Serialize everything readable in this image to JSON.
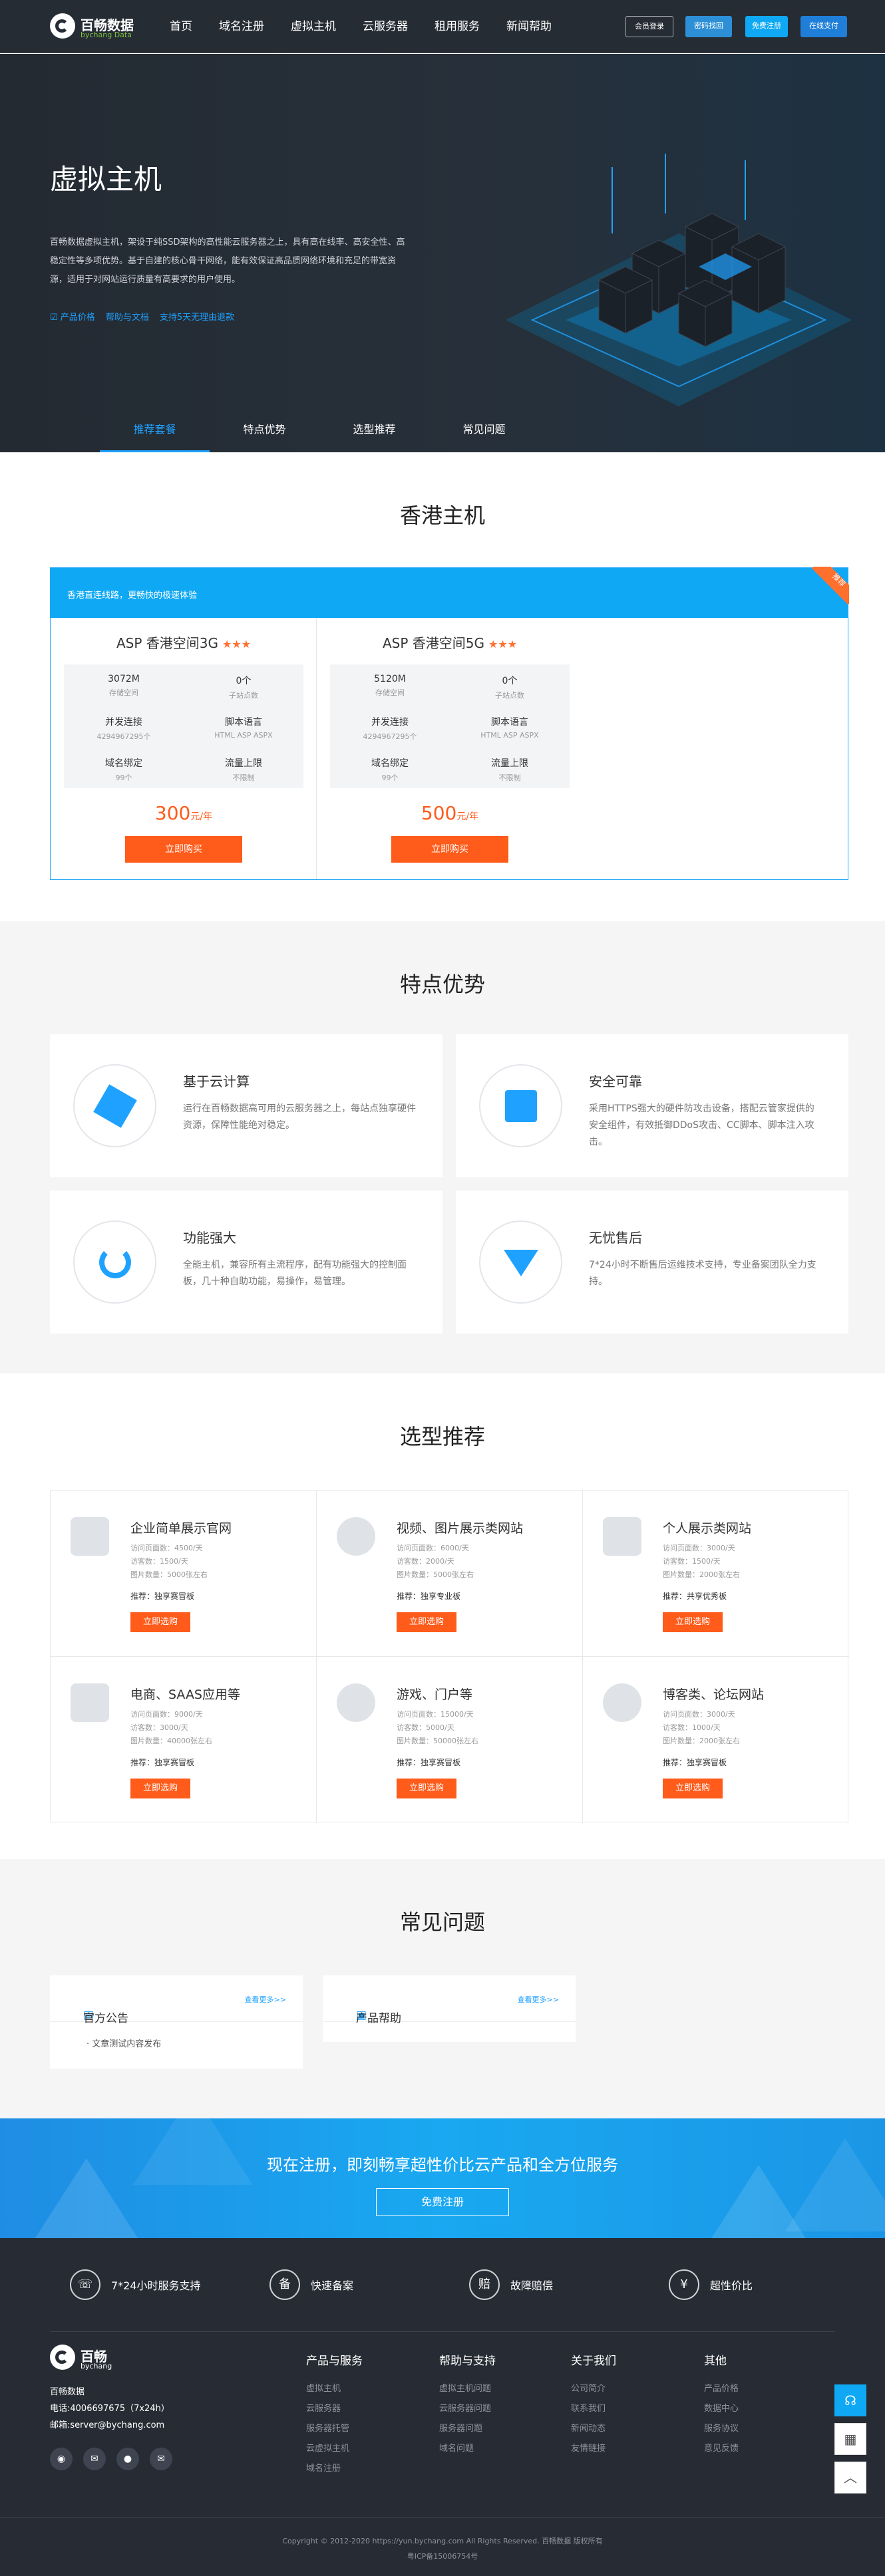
{
  "header": {
    "logo_cn": "百畅数据",
    "logo_en": "bychang Data",
    "nav": [
      "首页",
      "域名注册",
      "虚拟主机",
      "云服务器",
      "租用服务",
      "新闻帮助"
    ],
    "btn_login": "会员登录",
    "btn_find": "密码找回",
    "btn_register": "免费注册",
    "btn_pay": "在线支付"
  },
  "hero": {
    "title": "虚拟主机",
    "desc": "百畅数据虚拟主机，架设于纯SSD架构的高性能云服务器之上，具有高在线率、高安全性、高稳定性等多项优势。基于自建的核心骨干网络，能有效保证高品质网络环境和充足的带宽资源，适用于对网站运行质量有高要求的用户使用。",
    "features": [
      "产品价格",
      "帮助与文档",
      "支持5天无理由退款"
    ],
    "tabs": [
      "推荐套餐",
      "特点优势",
      "选型推荐",
      "常见问题"
    ]
  },
  "hk": {
    "title": "香港主机",
    "bar_text": "香港直连线路，更畅快的极速体验",
    "ribbon": "推荐",
    "plans": [
      {
        "name": "ASP 香港空间3G",
        "stars": "★★★",
        "cells": [
          {
            "v": "3072M",
            "l": "存储空间"
          },
          {
            "v": "0个",
            "l": "子站点数"
          },
          {
            "v": "并发连接",
            "l": "4294967295个"
          },
          {
            "v": "脚本语言",
            "l": "HTML ASP ASPX"
          },
          {
            "v": "域名绑定",
            "l": "99个"
          },
          {
            "v": "流量上限",
            "l": "不限制"
          }
        ],
        "price": "300",
        "unit": "元/年",
        "buy": "立即购买"
      },
      {
        "name": "ASP 香港空间5G",
        "stars": "★★★",
        "cells": [
          {
            "v": "5120M",
            "l": "存储空间"
          },
          {
            "v": "0个",
            "l": "子站点数"
          },
          {
            "v": "并发连接",
            "l": "4294967295个"
          },
          {
            "v": "脚本语言",
            "l": "HTML ASP ASPX"
          },
          {
            "v": "域名绑定",
            "l": "99个"
          },
          {
            "v": "流量上限",
            "l": "不限制"
          }
        ],
        "price": "500",
        "unit": "元/年",
        "buy": "立即购买"
      }
    ]
  },
  "features": {
    "title": "特点优势",
    "items": [
      {
        "title": "基于云计算",
        "desc": "运行在百畅数据高可用的云服务器之上，每站点独享硬件资源，保障性能绝对稳定。"
      },
      {
        "title": "安全可靠",
        "desc": "采用HTTPS强大的硬件防攻击设备，搭配云管家提供的安全组件，有效抵御DDoS攻击、CC脚本、脚本注入攻击。"
      },
      {
        "title": "功能强大",
        "desc": "全能主机，兼容所有主流程序，配有功能强大的控制面板，几十种自助功能，易操作，易管理。"
      },
      {
        "title": "无忧售后",
        "desc": "7*24小时不断售后运维技术支持，专业备案团队全力支持。"
      }
    ]
  },
  "recommend": {
    "title": "选型推荐",
    "items": [
      {
        "title": "企业简单展示官网",
        "l1": "访问页面数：4500/天",
        "l2": "访客数：1500/天",
        "l3": "图片数量：5000张左右",
        "rec": "推荐：独享赛冒板",
        "btn": "立即选购"
      },
      {
        "title": "视频、图片展示类网站",
        "l1": "访问页面数：6000/天",
        "l2": "访客数：2000/天",
        "l3": "图片数量：5000张左右",
        "rec": "推荐：独享专业板",
        "btn": "立即选购"
      },
      {
        "title": "个人展示类网站",
        "l1": "访问页面数：3000/天",
        "l2": "访客数：1500/天",
        "l3": "图片数量：2000张左右",
        "rec": "推荐：共享优秀板",
        "btn": "立即选购"
      },
      {
        "title": "电商、SAAS应用等",
        "l1": "访问页面数：9000/天",
        "l2": "访客数：3000/天",
        "l3": "图片数量：40000张左右",
        "rec": "推荐：独享赛冒板",
        "btn": "立即选购"
      },
      {
        "title": "游戏、门户等",
        "l1": "访问页面数：15000/天",
        "l2": "访客数：5000/天",
        "l3": "图片数量：50000张左右",
        "rec": "推荐：独享赛冒板",
        "btn": "立即选购"
      },
      {
        "title": "博客类、论坛网站",
        "l1": "访问页面数：3000/天",
        "l2": "访客数：1000/天",
        "l3": "图片数量：2000张左右",
        "rec": "推荐：独享赛冒板",
        "btn": "立即选购"
      }
    ]
  },
  "faq": {
    "title": "常见问题",
    "boxes": [
      {
        "title": "官方公告",
        "more": "查看更多>>",
        "items": [
          "文章测试内容发布"
        ]
      },
      {
        "title": "产品帮助",
        "more": "查看更多>>",
        "items": []
      }
    ]
  },
  "cta": {
    "title": "现在注册，即刻畅享超性价比云产品和全方位服务",
    "btn": "免费注册"
  },
  "footer": {
    "services": [
      {
        "icon": "☏",
        "label": "7*24小时服务支持"
      },
      {
        "icon": "备",
        "label": "快速备案"
      },
      {
        "icon": "赔",
        "label": "故障赔偿"
      },
      {
        "icon": "¥",
        "label": "超性价比"
      }
    ],
    "logo_cn": "百畅",
    "logo_en": "bychang",
    "company": "百畅数据",
    "phone": "电话:4006697675（7x24h）",
    "email": "邮箱:server@bychang.com",
    "columns": [
      {
        "title": "产品与服务",
        "links": [
          "虚拟主机",
          "云服务器",
          "服务器托管",
          "云虚拟主机",
          "域名注册"
        ]
      },
      {
        "title": "帮助与支持",
        "links": [
          "虚拟主机问题",
          "云服务器问题",
          "服务器问题",
          "域名问题"
        ]
      },
      {
        "title": "关于我们",
        "links": [
          "公司简介",
          "联系我们",
          "新闻动态",
          "友情链接"
        ]
      },
      {
        "title": "其他",
        "links": [
          "产品价格",
          "数据中心",
          "服务协议",
          "意见反馈"
        ]
      }
    ],
    "copyright": "Copyright © 2012-2020 https://yun.bychang.com All Rights Reserved. 百畅数据 版权所有",
    "icp": "粤ICP备15006754号"
  }
}
